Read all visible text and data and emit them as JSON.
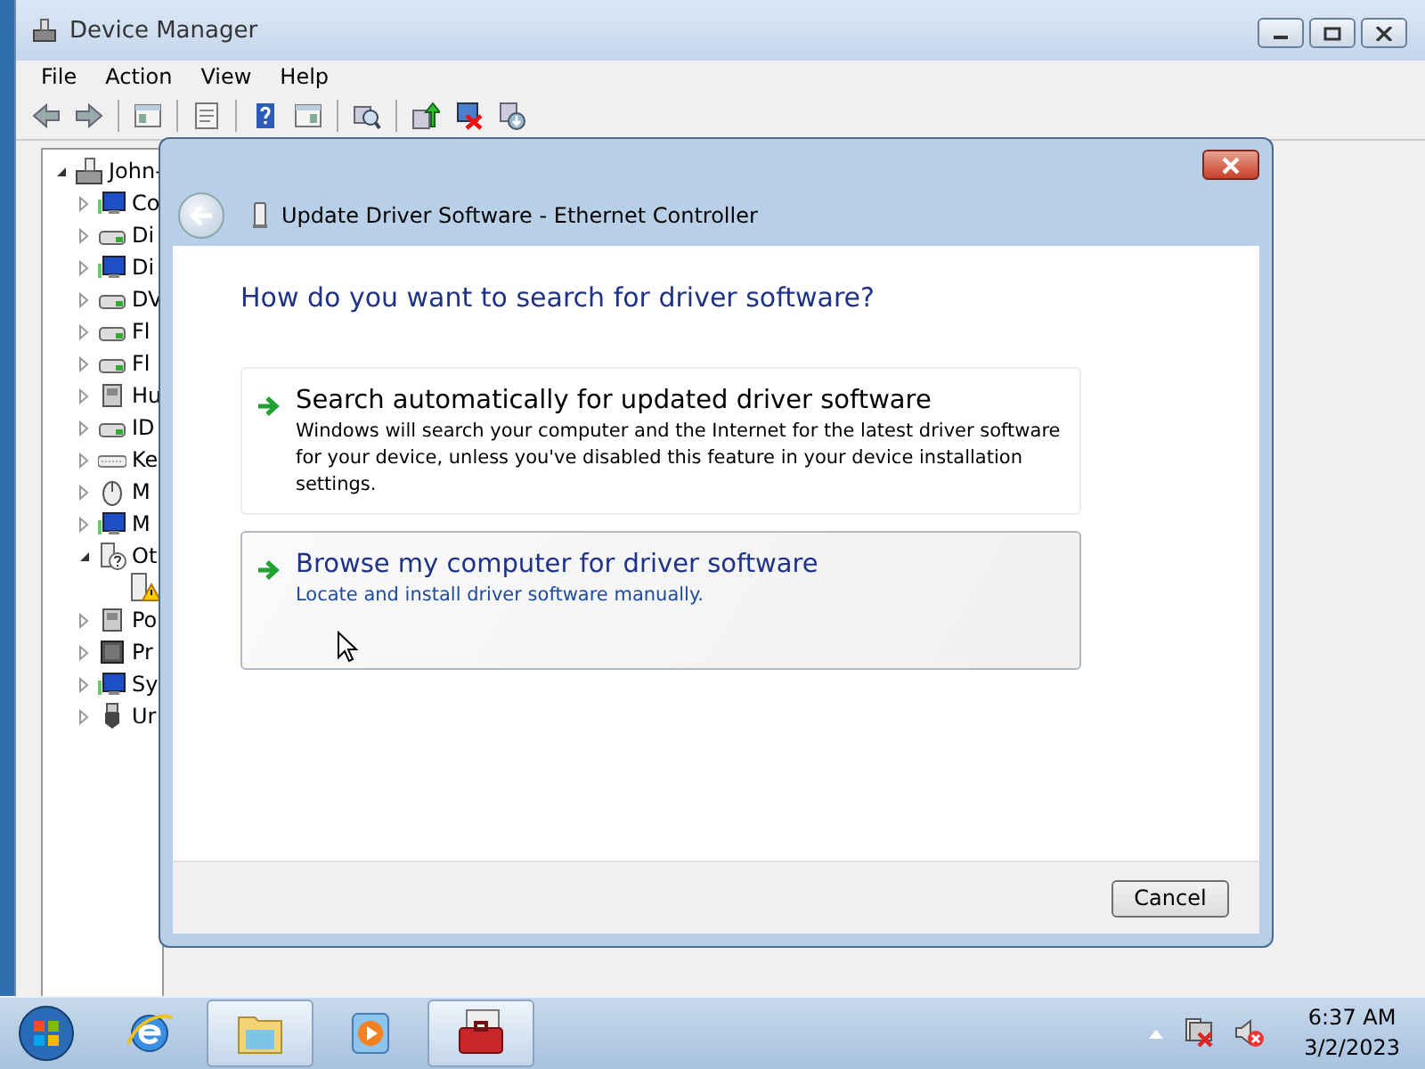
{
  "window": {
    "title": "Device Manager"
  },
  "menu": [
    "File",
    "Action",
    "View",
    "Help"
  ],
  "toolbar": [
    {
      "kind": "back"
    },
    {
      "kind": "forward"
    },
    {
      "kind": "sep"
    },
    {
      "kind": "tree"
    },
    {
      "kind": "sep"
    },
    {
      "kind": "props"
    },
    {
      "kind": "sep"
    },
    {
      "kind": "help"
    },
    {
      "kind": "pane"
    },
    {
      "kind": "sep"
    },
    {
      "kind": "scan"
    },
    {
      "kind": "sep"
    },
    {
      "kind": "update"
    },
    {
      "kind": "disable"
    },
    {
      "kind": "uninstall"
    }
  ],
  "tree": {
    "label": "John-",
    "expanded": true,
    "children": [
      {
        "label": "Co",
        "kind": "monitor",
        "expanded": false
      },
      {
        "label": "Di",
        "kind": "drive",
        "expanded": false
      },
      {
        "label": "Di",
        "kind": "monitor",
        "expanded": false
      },
      {
        "label": "DV",
        "kind": "drive",
        "expanded": false
      },
      {
        "label": "Fl",
        "kind": "drive",
        "expanded": false
      },
      {
        "label": "Fl",
        "kind": "drive",
        "expanded": false
      },
      {
        "label": "Hu",
        "kind": "device",
        "expanded": false
      },
      {
        "label": "ID",
        "kind": "drive",
        "expanded": false
      },
      {
        "label": "Ke",
        "kind": "keyboard",
        "expanded": false
      },
      {
        "label": "M",
        "kind": "mouse",
        "expanded": false
      },
      {
        "label": "M",
        "kind": "monitor",
        "expanded": false
      },
      {
        "label": "Ot",
        "kind": "unknown",
        "expanded": true,
        "children": [
          {
            "warning": true
          }
        ]
      },
      {
        "label": "Po",
        "kind": "device",
        "expanded": false
      },
      {
        "label": "Pr",
        "kind": "chip",
        "expanded": false
      },
      {
        "label": "Sy",
        "kind": "monitor",
        "expanded": false
      },
      {
        "label": "Ur",
        "kind": "usb",
        "expanded": false
      }
    ]
  },
  "dialog": {
    "title": "Update Driver Software - Ethernet Controller",
    "heading": "How do you want to search for driver software?",
    "options": [
      {
        "title": "Search automatically for updated driver software",
        "description": "Windows will search your computer and the Internet for the latest driver software for your device, unless you've disabled this feature in your device installation settings.",
        "hovered": false
      },
      {
        "title": "Browse my computer for driver software",
        "description": "Locate and install driver software manually.",
        "hovered": true
      }
    ],
    "buttons": [
      "Cancel"
    ]
  },
  "taskbar": {
    "apps": [
      {
        "kind": "browser",
        "active": false
      },
      {
        "kind": "folder",
        "active": true
      },
      {
        "kind": "media",
        "active": false
      },
      {
        "kind": "toolbox",
        "active": true
      }
    ],
    "time": "6:37 AM",
    "date": "3/2/2023"
  }
}
